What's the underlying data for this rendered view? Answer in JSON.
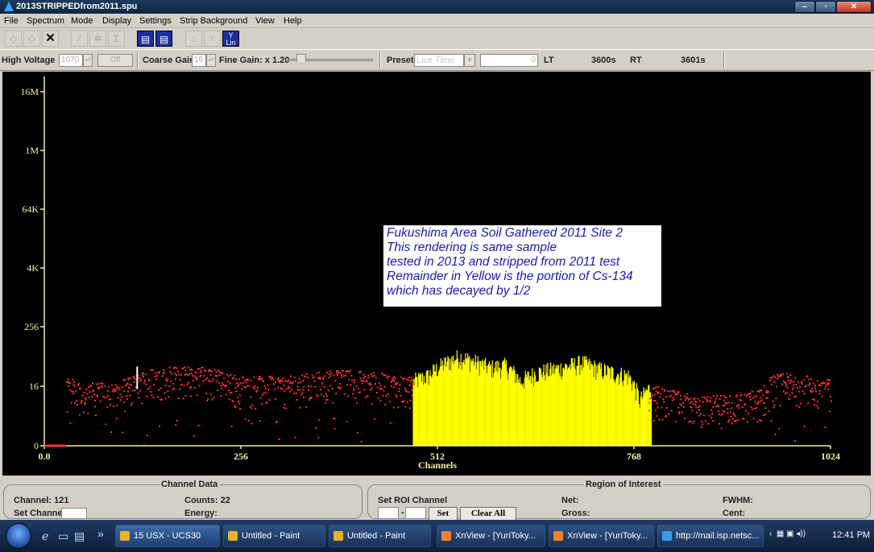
{
  "window": {
    "title": "2013STRIPPEDfrom2011.spu"
  },
  "menu": [
    "File",
    "Spectrum",
    "Mode",
    "Display",
    "Settings",
    "Strip Background",
    "View",
    "Help"
  ],
  "toolbar": {
    "icons": [
      "diamond-icon",
      "diamond-icon",
      "close-x-icon",
      "chart-icon",
      "gear-icon",
      "sigma-icon",
      "report-icon",
      "report-icon",
      "bell-icon",
      "y-log-icon",
      "y-lin-icon"
    ],
    "y_lin_label": "Y\nLin"
  },
  "controls": {
    "high_voltage_label": "High Voltage",
    "high_voltage_value": "1070",
    "hv_button": "Off",
    "coarse_gain_label": "Coarse Gain",
    "coarse_gain_value": "16",
    "fine_gain_label": "Fine Gain: x 1.20",
    "preset_label": "Preset",
    "preset_value": "Live Time",
    "preset_field": "0",
    "lt_label": "LT",
    "lt_value": "3600s",
    "rt_label": "RT",
    "rt_value": "3601s"
  },
  "annotation": [
    "Fukushima Area Soil Gathered 2011 Site 2",
    "This rendering is same sample",
    "tested in 2013 and stripped from 2011 test",
    "Remainder in Yellow is the portion of Cs-134",
    "which has decayed by 1/2"
  ],
  "chart_data": {
    "type": "bar",
    "xlabel": "Channels",
    "x_ticks": [
      "0.0",
      "256",
      "512",
      "768",
      "1024"
    ],
    "y_ticks": [
      "0",
      "16",
      "256",
      "4K",
      "64K",
      "1M",
      "16M"
    ],
    "xlim": [
      0,
      1024
    ],
    "y_scale": "log",
    "colors": {
      "background": "#000000",
      "axis": "#f2f09a",
      "text": "#f2f09a",
      "stripped_residual": "#ff3030",
      "cs134_region": "#ffff00",
      "marker": "#ffffff"
    },
    "cursor_channel": 121,
    "series": [
      {
        "values_note": "scatter",
        "points": [
          [
            40,
            12
          ],
          [
            96,
            12
          ],
          [
            144,
            24
          ],
          [
            200,
            26
          ],
          [
            256,
            16
          ],
          [
            320,
            16
          ],
          [
            384,
            22
          ],
          [
            448,
            18
          ],
          [
            512,
            12
          ],
          [
            560,
            14
          ],
          [
            640,
            10
          ],
          [
            704,
            14
          ],
          [
            768,
            8
          ],
          [
            800,
            10
          ],
          [
            850,
            6
          ],
          [
            900,
            7
          ],
          [
            935,
            9
          ],
          [
            950,
            18
          ],
          [
            980,
            18
          ],
          [
            1010,
            14
          ]
        ]
      },
      {
        "name": "Cs-134",
        "region": [
          480,
          790
        ],
        "values": [
          [
            480,
            20
          ],
          [
            500,
            26
          ],
          [
            520,
            45
          ],
          [
            540,
            64
          ],
          [
            560,
            50
          ],
          [
            580,
            38
          ],
          [
            600,
            42
          ],
          [
            620,
            20
          ],
          [
            640,
            30
          ],
          [
            660,
            34
          ],
          [
            680,
            40
          ],
          [
            700,
            48
          ],
          [
            720,
            36
          ],
          [
            740,
            30
          ],
          [
            760,
            26
          ],
          [
            775,
            8
          ],
          [
            790,
            16
          ]
        ]
      }
    ]
  },
  "bottom": {
    "channel_data_title": "Channel Data",
    "channel_label": "Channel: 121",
    "counts_label": "Counts: 22",
    "set_channel_label": "Set Channel",
    "energy_label": "Energy:",
    "roi_title": "Region of Interest",
    "set_roi_label": "Set ROI Channel",
    "roi_dash": "-",
    "set_button": "Set",
    "clear_all_button": "Clear All",
    "net_label": "Net:",
    "gross_label": "Gross:",
    "fwhm_label": "FWHM:",
    "cent_label": "Cent:"
  },
  "taskbar": {
    "quick_arrows": "»",
    "tasks": [
      "15 USX - UCS30",
      "Untitled - Paint",
      "Untitled - Paint",
      "XnView - [YuriToky...",
      "XnView - [YuriToky...",
      "http://mail.isp.netsc..."
    ],
    "tray_arrow": "‹",
    "clock": "12:41 PM"
  }
}
